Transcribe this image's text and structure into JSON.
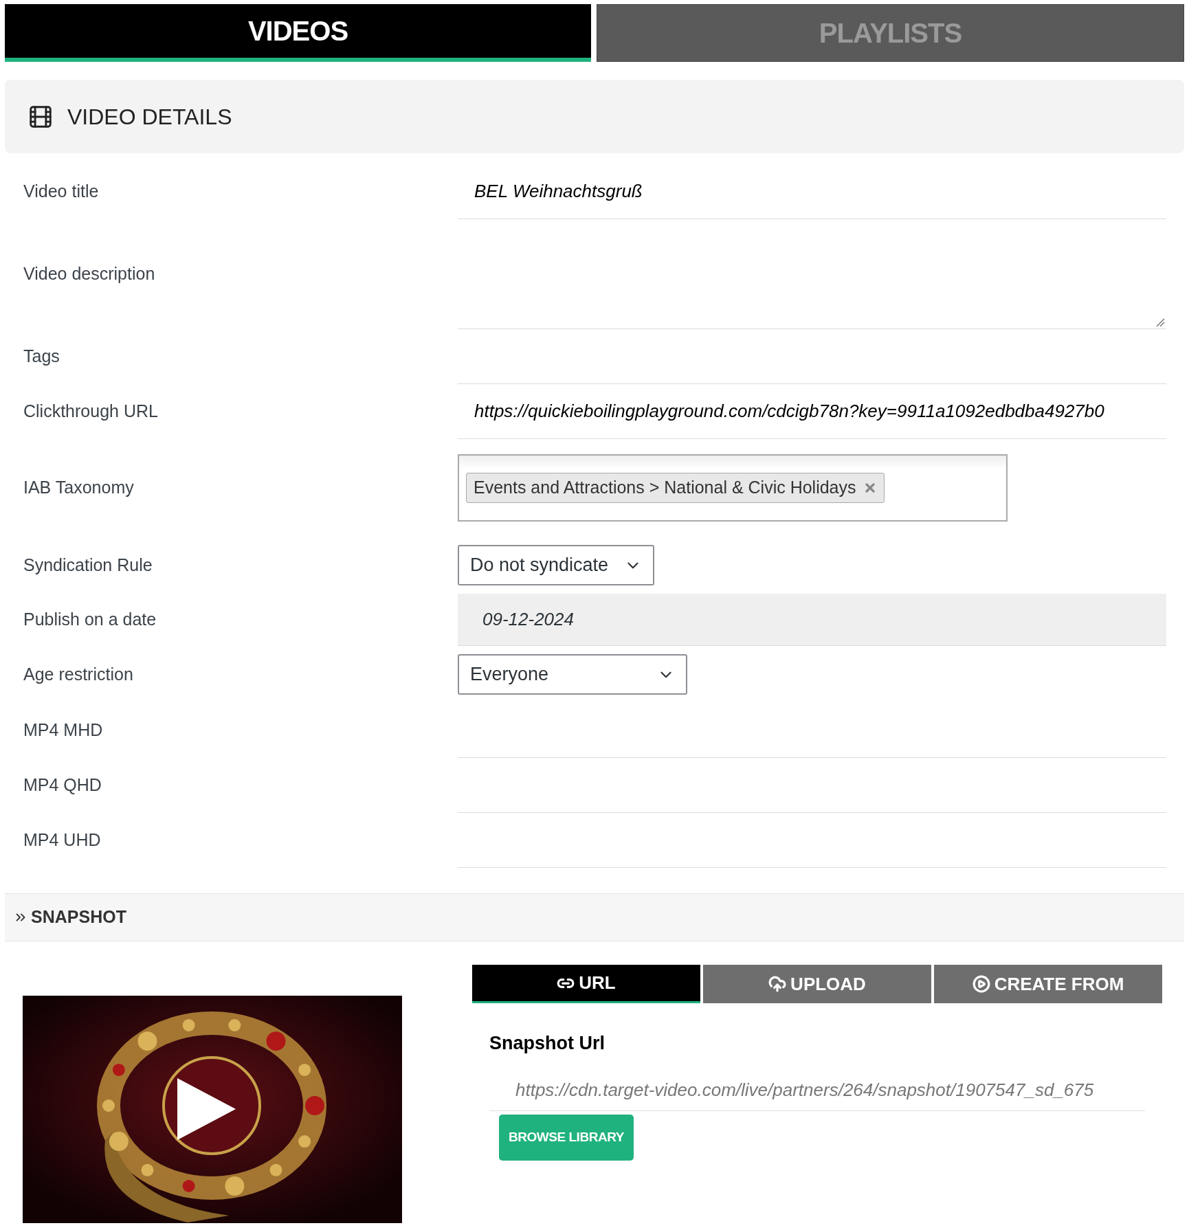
{
  "tabs": [
    {
      "label": "VIDEOS",
      "selected": true
    },
    {
      "label": "PLAYLISTS",
      "selected": false
    }
  ],
  "section": {
    "title": "VIDEO DETAILS"
  },
  "fields": [
    {
      "kind": "text",
      "label": "Video title",
      "value": "BEL Weihnachtsgruß"
    },
    {
      "kind": "textarea",
      "label": "Video description"
    },
    {
      "kind": "text",
      "label": "Tags"
    },
    {
      "kind": "text",
      "label": "Clickthrough URL",
      "value": "https://quickieboilingplayground.com/cdcigb78n?key=9911a1092edbdba4927b0"
    },
    {
      "kind": "chips",
      "label": "IAB Taxonomy",
      "chips": [
        "Events and Attractions > National & Civic Holidays"
      ]
    },
    {
      "kind": "select",
      "label": "Syndication Rule",
      "value": "Do not syndicate"
    },
    {
      "kind": "date",
      "label": "Publish on a date",
      "value": "09-12-2024"
    },
    {
      "kind": "select",
      "label": "Age restriction",
      "value": "Everyone",
      "wide": true
    },
    {
      "kind": "text",
      "label": "MP4 MHD"
    },
    {
      "kind": "text",
      "label": "MP4 QHD"
    },
    {
      "kind": "text",
      "label": "MP4 UHD"
    }
  ],
  "snapshot": {
    "title": "SNAPSHOT",
    "tabs": [
      {
        "label": "URL",
        "selected": true
      },
      {
        "label": "UPLOAD",
        "selected": false
      },
      {
        "label": "CREATE FROM",
        "selected": false
      }
    ],
    "url_label": "Snapshot Url",
    "url": "https://cdn.target-video.com/live/partners/264/snapshot/1907547_sd_675",
    "button": "BROWSE LIBRARY"
  }
}
